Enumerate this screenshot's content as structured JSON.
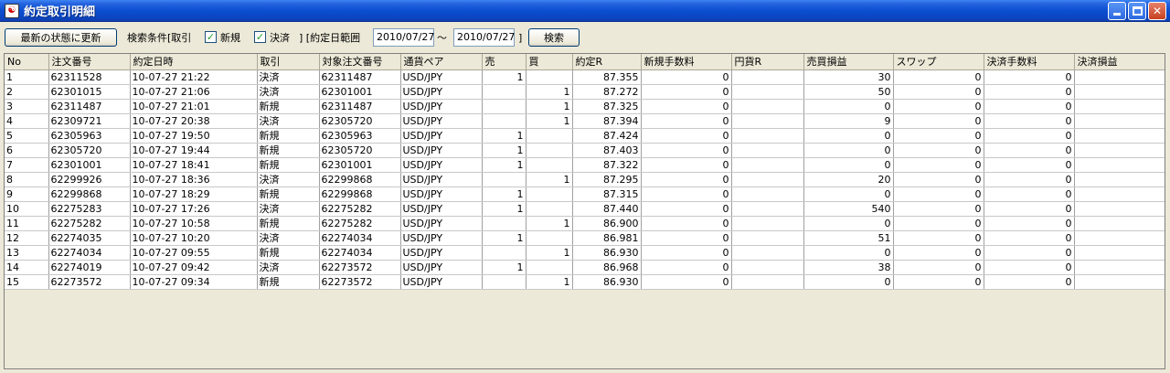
{
  "window": {
    "title": "約定取引明細",
    "buttons": {
      "minimize": "minimize",
      "maximize": "maximize",
      "close": "close"
    }
  },
  "toolbar": {
    "refresh_label": "最新の状態に更新",
    "filter_label": "検索条件[取引",
    "new_label": "新規",
    "settle_label": "決済",
    "range_label": "] [約定日範囲",
    "date_from": "2010/07/27",
    "tilde": "～",
    "date_to": "2010/07/27",
    "close_bracket": "]",
    "search_label": "検索",
    "new_checked": true,
    "settle_checked": true
  },
  "table": {
    "columns": [
      "No",
      "注文番号",
      "約定日時",
      "取引",
      "対象注文番号",
      "通貨ペア",
      "売",
      "買",
      "約定R",
      "新規手数料",
      "円貨R",
      "売買損益",
      "スワップ",
      "決済手数料",
      "決済損益"
    ],
    "rows": [
      [
        "1",
        "62311528",
        "10-07-27 21:22",
        "決済",
        "62311487",
        "USD/JPY",
        "1",
        "",
        "87.355",
        "0",
        "",
        "30",
        "0",
        "0",
        "30"
      ],
      [
        "2",
        "62301015",
        "10-07-27 21:06",
        "決済",
        "62301001",
        "USD/JPY",
        "",
        "1",
        "87.272",
        "0",
        "",
        "50",
        "0",
        "0",
        "50"
      ],
      [
        "3",
        "62311487",
        "10-07-27 21:01",
        "新規",
        "62311487",
        "USD/JPY",
        "",
        "1",
        "87.325",
        "0",
        "",
        "0",
        "0",
        "0",
        "0"
      ],
      [
        "4",
        "62309721",
        "10-07-27 20:38",
        "決済",
        "62305720",
        "USD/JPY",
        "",
        "1",
        "87.394",
        "0",
        "",
        "9",
        "0",
        "0",
        "9"
      ],
      [
        "5",
        "62305963",
        "10-07-27 19:50",
        "新規",
        "62305963",
        "USD/JPY",
        "1",
        "",
        "87.424",
        "0",
        "",
        "0",
        "0",
        "0",
        "0"
      ],
      [
        "6",
        "62305720",
        "10-07-27 19:44",
        "新規",
        "62305720",
        "USD/JPY",
        "1",
        "",
        "87.403",
        "0",
        "",
        "0",
        "0",
        "0",
        "0"
      ],
      [
        "7",
        "62301001",
        "10-07-27 18:41",
        "新規",
        "62301001",
        "USD/JPY",
        "1",
        "",
        "87.322",
        "0",
        "",
        "0",
        "0",
        "0",
        "0"
      ],
      [
        "8",
        "62299926",
        "10-07-27 18:36",
        "決済",
        "62299868",
        "USD/JPY",
        "",
        "1",
        "87.295",
        "0",
        "",
        "20",
        "0",
        "0",
        "20"
      ],
      [
        "9",
        "62299868",
        "10-07-27 18:29",
        "新規",
        "62299868",
        "USD/JPY",
        "1",
        "",
        "87.315",
        "0",
        "",
        "0",
        "0",
        "0",
        "0"
      ],
      [
        "10",
        "62275283",
        "10-07-27 17:26",
        "決済",
        "62275282",
        "USD/JPY",
        "1",
        "",
        "87.440",
        "0",
        "",
        "540",
        "0",
        "0",
        "540"
      ],
      [
        "11",
        "62275282",
        "10-07-27 10:58",
        "新規",
        "62275282",
        "USD/JPY",
        "",
        "1",
        "86.900",
        "0",
        "",
        "0",
        "0",
        "0",
        "0"
      ],
      [
        "12",
        "62274035",
        "10-07-27 10:20",
        "決済",
        "62274034",
        "USD/JPY",
        "1",
        "",
        "86.981",
        "0",
        "",
        "51",
        "0",
        "0",
        "51"
      ],
      [
        "13",
        "62274034",
        "10-07-27 09:55",
        "新規",
        "62274034",
        "USD/JPY",
        "",
        "1",
        "86.930",
        "0",
        "",
        "0",
        "0",
        "0",
        "0"
      ],
      [
        "14",
        "62274019",
        "10-07-27 09:42",
        "決済",
        "62273572",
        "USD/JPY",
        "1",
        "",
        "86.968",
        "0",
        "",
        "38",
        "0",
        "0",
        "38"
      ],
      [
        "15",
        "62273572",
        "10-07-27 09:34",
        "新規",
        "62273572",
        "USD/JPY",
        "",
        "1",
        "86.930",
        "0",
        "",
        "0",
        "0",
        "0",
        "0"
      ]
    ]
  },
  "colors": {
    "title_bar": "#0a46c4",
    "window_bg": "#ece9d8",
    "check_mark": "#21a121"
  }
}
